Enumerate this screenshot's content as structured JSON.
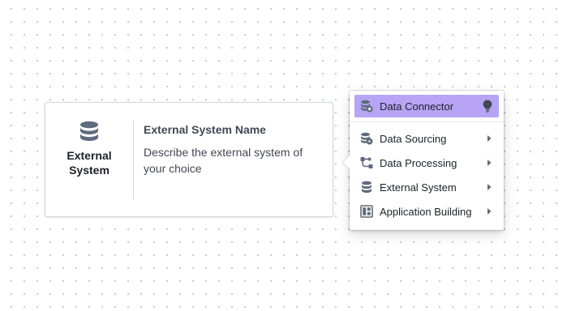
{
  "node": {
    "type_label_line1": "External",
    "type_label_line2": "System",
    "title": "External System Name",
    "description": "Describe the external system of your choice",
    "type_icon": "database-icon"
  },
  "menu": {
    "items": [
      {
        "label": "Data Connector",
        "icon": "data-connector-icon",
        "trailing": "lightbulb-icon",
        "selected": true
      },
      {
        "label": "Data Sourcing",
        "icon": "data-sourcing-icon",
        "trailing": "caret-right-icon"
      },
      {
        "label": "Data Processing",
        "icon": "data-processing-icon",
        "trailing": "caret-right-icon"
      },
      {
        "label": "External System",
        "icon": "database-icon",
        "trailing": "caret-right-icon"
      },
      {
        "label": "Application Building",
        "icon": "application-building-icon",
        "trailing": "caret-right-icon"
      }
    ]
  },
  "colors": {
    "selected_item_bg": "#b7a4f4",
    "icon_gray": "#5f6b7c",
    "text_dark": "#1c2127",
    "text_secondary": "#404854"
  }
}
